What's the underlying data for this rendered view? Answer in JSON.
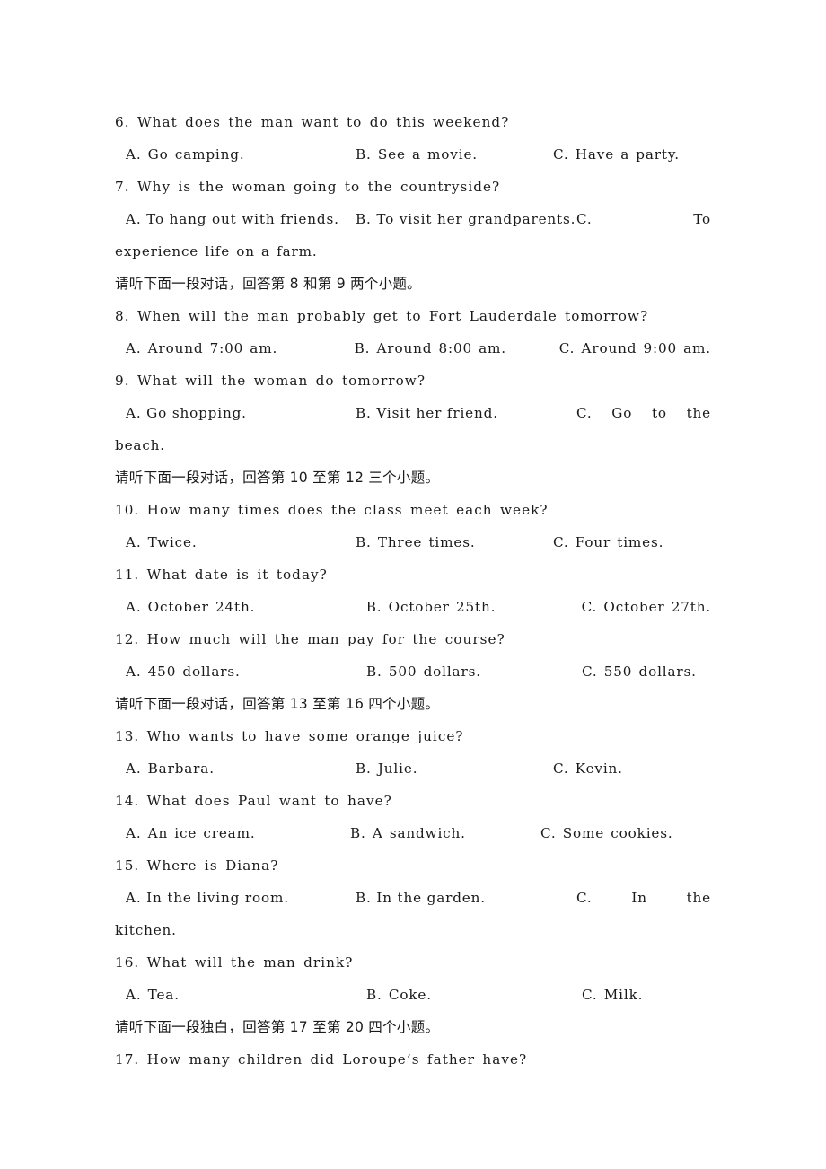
{
  "document": {
    "type": "english-listening-exam-page",
    "language_mix": [
      "en",
      "zh-CN"
    ],
    "background_color": "#ffffff",
    "text_color": "#1a1a1a"
  },
  "blocks": [
    {
      "kind": "question",
      "number": "6.",
      "stem": "6.  What does the man want to do this weekend?",
      "options": {
        "a": "A. Go camping.",
        "b": "B. See a movie.",
        "c": "C. Have a party."
      }
    },
    {
      "kind": "question",
      "number": "7.",
      "stem": "7. Why is the woman going to the countryside?",
      "options": {
        "a": "A. To hang out with friends.",
        "b": "B. To visit her grandparents.",
        "c_part1": "C.",
        "c_part2": "To"
      },
      "continuation": "experience life on a farm."
    },
    {
      "kind": "instruction",
      "text": "请听下面一段对话，回答第 8 和第 9 两个小题。"
    },
    {
      "kind": "question",
      "number": "8.",
      "stem": "8. When will the man probably get to Fort Lauderdale tomorrow?",
      "options": {
        "a": "A. Around 7:00 am.",
        "b": "B. Around 8:00 am.",
        "c": "C. Around 9:00 am."
      }
    },
    {
      "kind": "question",
      "number": "9.",
      "stem": "9. What will the woman do tomorrow?",
      "options": {
        "a": "A. Go shopping.",
        "b": "B. Visit her friend.",
        "c_part1": "C.",
        "c_part2": "Go",
        "c_part3": "to",
        "c_part4": "the"
      },
      "continuation": "beach."
    },
    {
      "kind": "instruction",
      "text": "请听下面一段对话，回答第 10 至第 12 三个小题。"
    },
    {
      "kind": "question",
      "number": "10.",
      "stem": "10. How many times does the class meet each week?",
      "options": {
        "a": "A. Twice.",
        "b": "B. Three times.",
        "c": "C. Four times."
      }
    },
    {
      "kind": "question",
      "number": "11.",
      "stem": "11. What date is it today?",
      "options": {
        "a": "A. October 24th.",
        "b": "B. October 25th.",
        "c": "C. October 27th."
      }
    },
    {
      "kind": "question",
      "number": "12.",
      "stem": "12. How much will the man pay for the course?",
      "options": {
        "a": "A. 450 dollars.",
        "b": "B. 500 dollars.",
        "c": "C. 550 dollars."
      }
    },
    {
      "kind": "instruction",
      "text": "请听下面一段对话，回答第 13 至第 16 四个小题。"
    },
    {
      "kind": "question",
      "number": "13.",
      "stem": "13. Who wants to have some orange juice?",
      "options": {
        "a": "A. Barbara.",
        "b": "B. Julie.",
        "c": "C. Kevin."
      }
    },
    {
      "kind": "question",
      "number": "14.",
      "stem": "14. What does Paul want to have?",
      "options": {
        "a": "A. An ice cream.",
        "b": "B. A sandwich.",
        "c": "C. Some cookies."
      }
    },
    {
      "kind": "question",
      "number": "15.",
      "stem": "15. Where is Diana?",
      "options": {
        "a": "A. In the living room.",
        "b": "B. In the garden.",
        "c_part1": "C.",
        "c_part2": "In",
        "c_part3": "the"
      },
      "continuation": "kitchen."
    },
    {
      "kind": "question",
      "number": "16.",
      "stem": "16. What will the man drink?",
      "options": {
        "a": "A. Tea.",
        "b": "B. Coke.",
        "c": "C. Milk."
      }
    },
    {
      "kind": "instruction",
      "text": "请听下面一段独白，回答第 17 至第 20 四个小题。"
    },
    {
      "kind": "question",
      "number": "17.",
      "stem": "17. How many children did Loroupe’s father have?",
      "options": null
    }
  ]
}
